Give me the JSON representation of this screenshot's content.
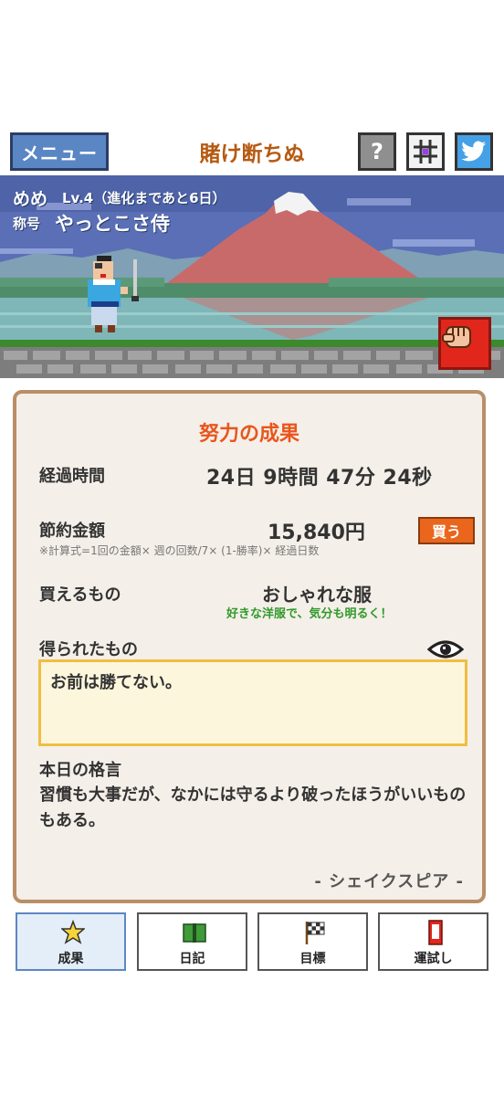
{
  "header": {
    "menu_label": "メニュー",
    "title": "賭け断ちぬ",
    "help_label": "?",
    "help_icon": "question-icon",
    "grid_icon": "grid-icon",
    "share_icon": "twitter-bird-icon"
  },
  "player": {
    "name": "めめ",
    "level": "Lv.4（進化まであと6日）",
    "title_label": "称号",
    "title_value": "やっとこさ侍"
  },
  "card": {
    "heading": "努力の成果",
    "elapsed_label": "経過時間",
    "elapsed_value": "24日 9時間 47分 24秒",
    "savings_label": "節約金額",
    "savings_value": "15,840円",
    "savings_formula": "※計算式=1回の金額× 週の回数/7× (1-勝率)× 経過日数",
    "buy_label": "買う",
    "purchasable_label": "買えるもの",
    "purchasable_value": "おしゃれな服",
    "purchasable_desc": "好きな洋服で、気分も明るく！",
    "gained_label": "得られたもの",
    "gained_text": "お前は勝てない。",
    "quote_label": "本日の格言",
    "quote_text": "習慣も大事だが、なかには守るより破ったほうがいいものもある。",
    "quote_author": "- シェイクスピア -"
  },
  "nav": {
    "tabs": [
      {
        "label": "成果",
        "icon": "star-icon",
        "active": true
      },
      {
        "label": "日記",
        "icon": "book-icon",
        "active": false
      },
      {
        "label": "目標",
        "icon": "flag-icon",
        "active": false
      },
      {
        "label": "運試し",
        "icon": "fortune-slip-icon",
        "active": false
      }
    ]
  },
  "colors": {
    "accent_blue": "#5b86c4",
    "title_brown": "#b65a12",
    "heading_orange": "#e8561c",
    "buy_orange": "#e9661c",
    "fist_red": "#e1261c",
    "card_bg": "#f5efe9",
    "card_border": "#b98e68",
    "memo_bg": "#fcf6dc",
    "memo_border": "#efbe42",
    "desc_green": "#2f9a2a"
  }
}
